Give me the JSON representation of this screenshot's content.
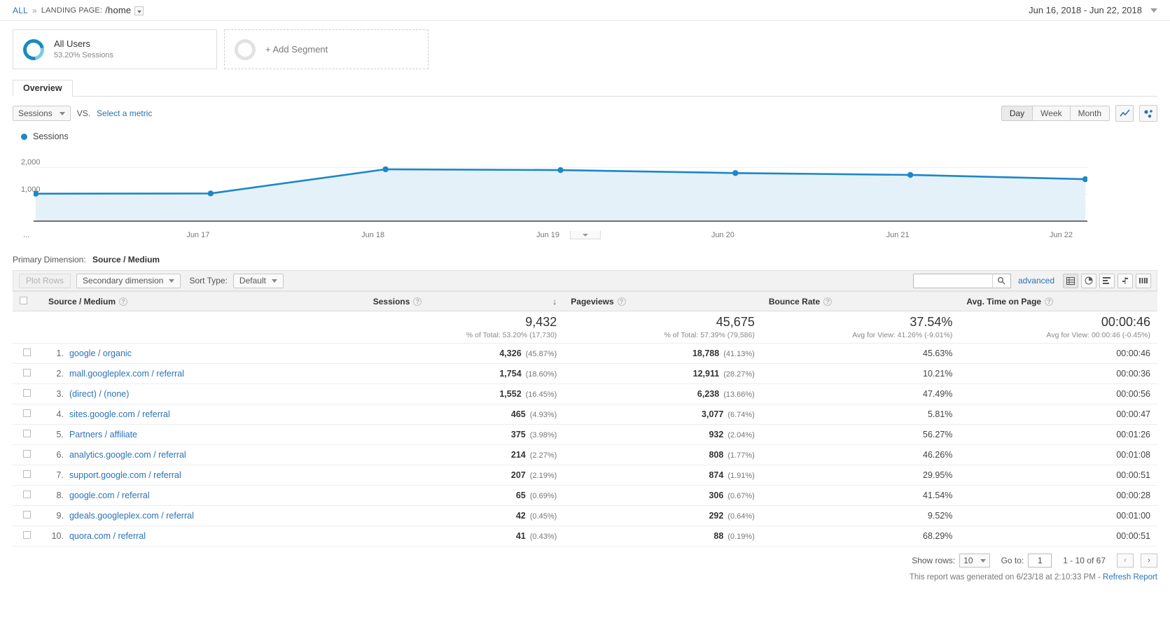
{
  "breadcrumb": {
    "all": "ALL",
    "separator": "»",
    "scope_label": "LANDING PAGE:",
    "scope_value": "/home"
  },
  "date_range": {
    "value": "Jun 16, 2018 - Jun 22, 2018"
  },
  "segments": [
    {
      "name": "All Users",
      "sub": "53.20% Sessions"
    },
    {
      "name": "+ Add Segment",
      "sub": ""
    }
  ],
  "tabs": [
    {
      "label": "Overview",
      "active": true
    }
  ],
  "metric_row": {
    "metric": "Sessions",
    "vs": "VS.",
    "select_metric": "Select a metric",
    "granularity": [
      "Day",
      "Week",
      "Month"
    ],
    "granularity_active": "Day"
  },
  "legend": {
    "label": "Sessions",
    "color": "#1b87c9"
  },
  "chart_data": {
    "type": "line",
    "title": "Sessions",
    "xlabel": "",
    "ylabel": "Sessions",
    "grid": true,
    "legend_position": "top-left",
    "ylim": [
      0,
      2500
    ],
    "yticks": [
      1000,
      2000
    ],
    "ytick_labels": [
      "1,000",
      "2,000"
    ],
    "x": [
      "Jun 16",
      "Jun 17",
      "Jun 18",
      "Jun 19",
      "Jun 20",
      "Jun 21",
      "Jun 22"
    ],
    "xtick_labels": [
      "...",
      "Jun 17",
      "Jun 18",
      "Jun 19",
      "Jun 20",
      "Jun 21",
      "Jun 22"
    ],
    "series": [
      {
        "name": "Sessions",
        "color": "#1b87c9",
        "values": [
          1020,
          1030,
          1930,
          1900,
          1790,
          1720,
          1560
        ]
      }
    ]
  },
  "primary_dimension": {
    "label": "Primary Dimension:",
    "value": "Source / Medium"
  },
  "table_toolbar": {
    "plot_rows": "Plot Rows",
    "secondary_dimension": "Secondary dimension",
    "sort_type_label": "Sort Type:",
    "sort_type_value": "Default",
    "search_value": "",
    "advanced": "advanced"
  },
  "table": {
    "columns": [
      "Source / Medium",
      "Sessions",
      "Pageviews",
      "Bounce Rate",
      "Avg. Time on Page"
    ],
    "sorted_column": "Sessions",
    "sort_direction": "desc",
    "summary": [
      {
        "value": "9,432",
        "sub": "% of Total: 53.20% (17,730)"
      },
      {
        "value": "45,675",
        "sub": "% of Total: 57.39% (79,586)"
      },
      {
        "value": "37.54%",
        "sub": "Avg for View: 41.26% (-9.01%)"
      },
      {
        "value": "00:00:46",
        "sub": "Avg for View: 00:00:46 (-0.45%)"
      }
    ],
    "rows": [
      {
        "n": "1.",
        "dim": "google / organic",
        "sessions": "4,326",
        "sessions_pct": "(45.87%)",
        "pageviews": "18,788",
        "pageviews_pct": "(41.13%)",
        "bounce": "45.63%",
        "time": "00:00:46"
      },
      {
        "n": "2.",
        "dim": "mall.googleplex.com / referral",
        "sessions": "1,754",
        "sessions_pct": "(18.60%)",
        "pageviews": "12,911",
        "pageviews_pct": "(28.27%)",
        "bounce": "10.21%",
        "time": "00:00:36"
      },
      {
        "n": "3.",
        "dim": "(direct) / (none)",
        "sessions": "1,552",
        "sessions_pct": "(16.45%)",
        "pageviews": "6,238",
        "pageviews_pct": "(13.66%)",
        "bounce": "47.49%",
        "time": "00:00:56"
      },
      {
        "n": "4.",
        "dim": "sites.google.com / referral",
        "sessions": "465",
        "sessions_pct": "(4.93%)",
        "pageviews": "3,077",
        "pageviews_pct": "(6.74%)",
        "bounce": "5.81%",
        "time": "00:00:47"
      },
      {
        "n": "5.",
        "dim": "Partners / affiliate",
        "sessions": "375",
        "sessions_pct": "(3.98%)",
        "pageviews": "932",
        "pageviews_pct": "(2.04%)",
        "bounce": "56.27%",
        "time": "00:01:26"
      },
      {
        "n": "6.",
        "dim": "analytics.google.com / referral",
        "sessions": "214",
        "sessions_pct": "(2.27%)",
        "pageviews": "808",
        "pageviews_pct": "(1.77%)",
        "bounce": "46.26%",
        "time": "00:01:08"
      },
      {
        "n": "7.",
        "dim": "support.google.com / referral",
        "sessions": "207",
        "sessions_pct": "(2.19%)",
        "pageviews": "874",
        "pageviews_pct": "(1.91%)",
        "bounce": "29.95%",
        "time": "00:00:51"
      },
      {
        "n": "8.",
        "dim": "google.com / referral",
        "sessions": "65",
        "sessions_pct": "(0.69%)",
        "pageviews": "306",
        "pageviews_pct": "(0.67%)",
        "bounce": "41.54%",
        "time": "00:00:28"
      },
      {
        "n": "9.",
        "dim": "gdeals.googleplex.com / referral",
        "sessions": "42",
        "sessions_pct": "(0.45%)",
        "pageviews": "292",
        "pageviews_pct": "(0.64%)",
        "bounce": "9.52%",
        "time": "00:01:00"
      },
      {
        "n": "10.",
        "dim": "quora.com / referral",
        "sessions": "41",
        "sessions_pct": "(0.43%)",
        "pageviews": "88",
        "pageviews_pct": "(0.19%)",
        "bounce": "68.29%",
        "time": "00:00:51"
      }
    ]
  },
  "footer": {
    "show_rows_label": "Show rows:",
    "show_rows_value": "10",
    "go_to_label": "Go to:",
    "go_to_value": "1",
    "range": "1 - 10 of 67",
    "generated": "This report was generated on 6/23/18 at 2:10:33 PM -",
    "refresh": "Refresh Report"
  }
}
